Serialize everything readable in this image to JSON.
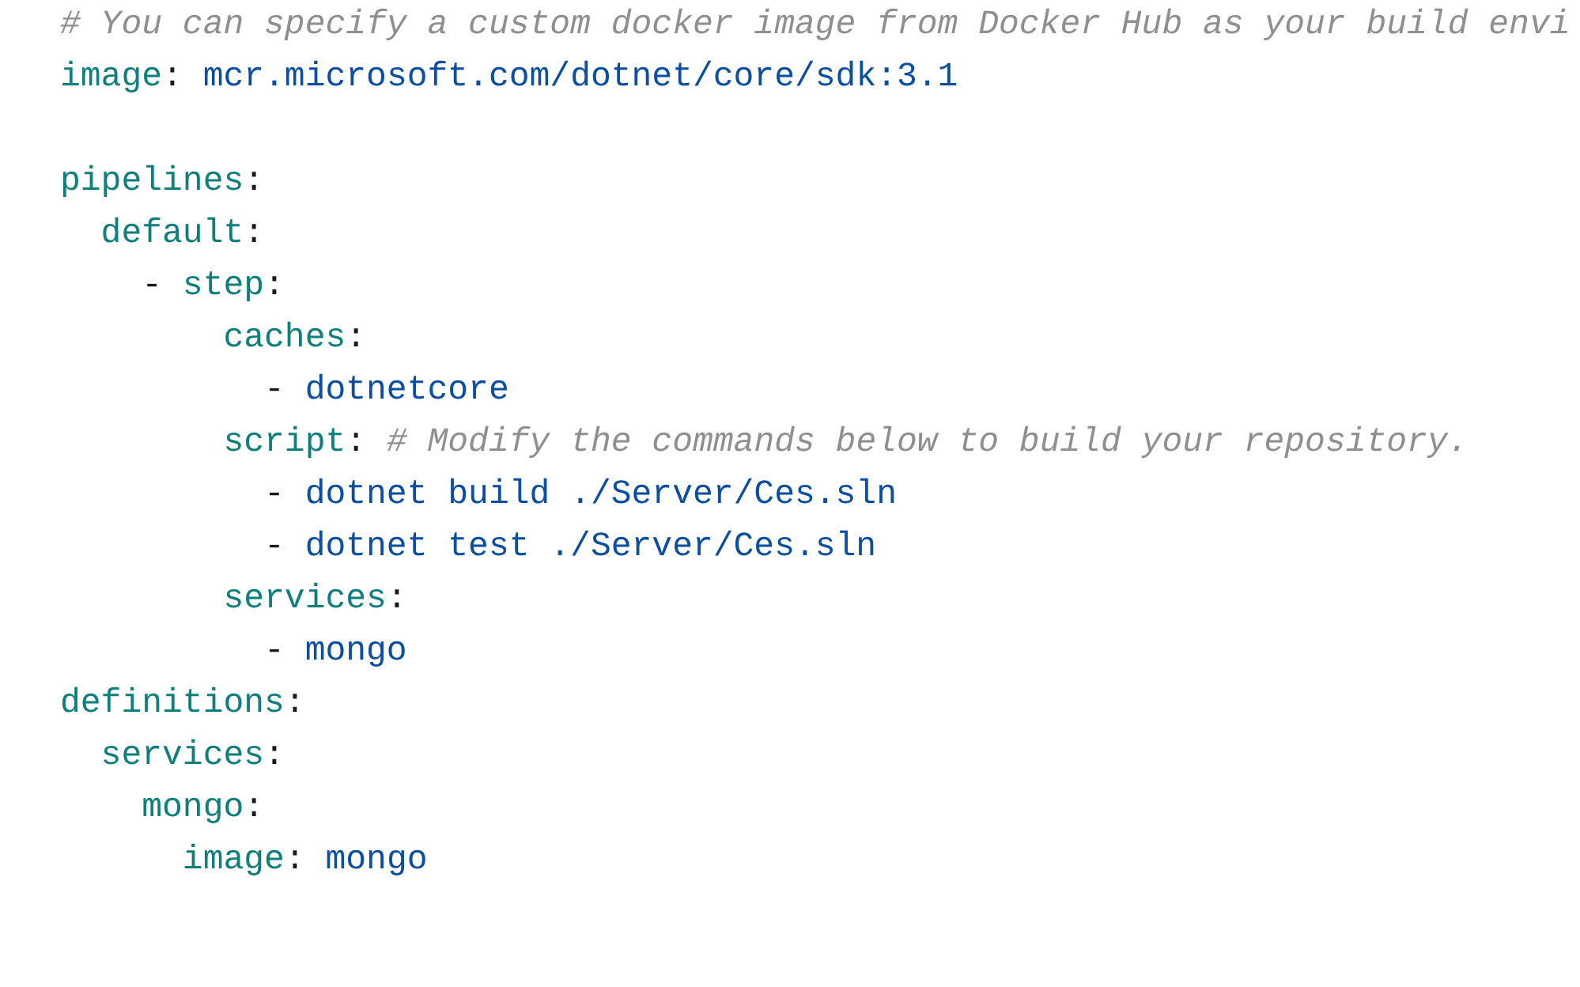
{
  "lines": [
    {
      "kind": "code",
      "tokens": [
        {
          "kind": "comment",
          "text": "# You can specify a custom docker image from Docker Hub as your build envi"
        }
      ]
    },
    {
      "kind": "code",
      "tokens": [
        {
          "kind": "key",
          "text": "image"
        },
        {
          "kind": "punct",
          "text": ": "
        },
        {
          "kind": "value",
          "text": "mcr.microsoft.com/dotnet/core/sdk:3.1"
        }
      ]
    },
    {
      "kind": "blank"
    },
    {
      "kind": "code",
      "tokens": [
        {
          "kind": "key",
          "text": "pipelines"
        },
        {
          "kind": "punct",
          "text": ":"
        }
      ]
    },
    {
      "kind": "code",
      "tokens": [
        {
          "kind": "key",
          "text": "  default"
        },
        {
          "kind": "punct",
          "text": ":"
        }
      ]
    },
    {
      "kind": "code",
      "tokens": [
        {
          "kind": "punct",
          "text": "    - "
        },
        {
          "kind": "key",
          "text": "step"
        },
        {
          "kind": "punct",
          "text": ":"
        }
      ]
    },
    {
      "kind": "code",
      "tokens": [
        {
          "kind": "key",
          "text": "        caches"
        },
        {
          "kind": "punct",
          "text": ":"
        }
      ]
    },
    {
      "kind": "code",
      "tokens": [
        {
          "kind": "punct",
          "text": "          - "
        },
        {
          "kind": "value",
          "text": "dotnetcore"
        }
      ]
    },
    {
      "kind": "code",
      "tokens": [
        {
          "kind": "key",
          "text": "        script"
        },
        {
          "kind": "punct",
          "text": ": "
        },
        {
          "kind": "comment",
          "text": "# Modify the commands below to build your repository."
        }
      ]
    },
    {
      "kind": "code",
      "tokens": [
        {
          "kind": "punct",
          "text": "          - "
        },
        {
          "kind": "value",
          "text": "dotnet build ./Server/Ces.sln"
        }
      ]
    },
    {
      "kind": "code",
      "tokens": [
        {
          "kind": "punct",
          "text": "          - "
        },
        {
          "kind": "value",
          "text": "dotnet test ./Server/Ces.sln"
        }
      ]
    },
    {
      "kind": "code",
      "tokens": [
        {
          "kind": "key",
          "text": "        services"
        },
        {
          "kind": "punct",
          "text": ":"
        }
      ]
    },
    {
      "kind": "code",
      "tokens": [
        {
          "kind": "punct",
          "text": "          - "
        },
        {
          "kind": "value",
          "text": "mongo"
        }
      ]
    },
    {
      "kind": "code",
      "tokens": [
        {
          "kind": "key",
          "text": "definitions"
        },
        {
          "kind": "punct",
          "text": ":"
        }
      ]
    },
    {
      "kind": "code",
      "tokens": [
        {
          "kind": "key",
          "text": "  services"
        },
        {
          "kind": "punct",
          "text": ":"
        }
      ]
    },
    {
      "kind": "code",
      "tokens": [
        {
          "kind": "key",
          "text": "    mongo"
        },
        {
          "kind": "punct",
          "text": ":"
        }
      ]
    },
    {
      "kind": "code",
      "tokens": [
        {
          "kind": "key",
          "text": "      image"
        },
        {
          "kind": "punct",
          "text": ": "
        },
        {
          "kind": "value",
          "text": "mongo"
        }
      ]
    }
  ]
}
